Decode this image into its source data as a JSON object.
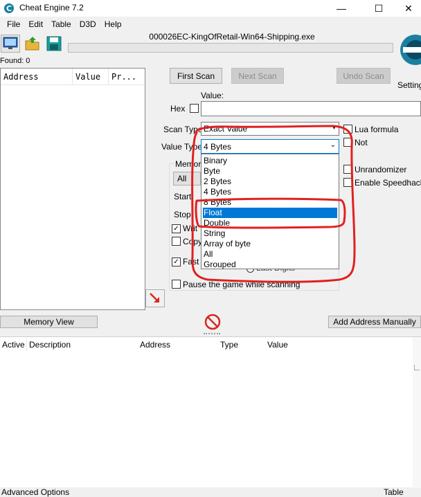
{
  "window": {
    "title": "Cheat Engine 7.2",
    "minimize": "—",
    "maximize": "☐",
    "close": "✕"
  },
  "menu": [
    "File",
    "Edit",
    "Table",
    "D3D",
    "Help"
  ],
  "process": {
    "name": "000026EC-KingOfRetail-Win64-Shipping.exe",
    "found_label": "Found: 0"
  },
  "address_list": {
    "columns": [
      "Address",
      "Value",
      "Pr..."
    ]
  },
  "scan": {
    "first_scan": "First Scan",
    "next_scan": "Next Scan",
    "undo_scan": "Undo Scan",
    "settings": "Settings",
    "value_label": "Value:",
    "hex_label": "Hex",
    "scan_type_label": "Scan Type",
    "scan_type_value": "Exact Value",
    "value_type_label": "Value Type",
    "value_type_value": "4 Bytes",
    "memory_label": "Memor",
    "all_label": "All",
    "start_label": "Start",
    "stop_label": "Stop",
    "writable_label": "Writ",
    "copy_label": "Copy",
    "fast_label": "Fast S",
    "last_digits": "Last Digits",
    "pause_label": "Pause the game while scanning"
  },
  "options": {
    "lua_formula": "Lua formula",
    "not": "Not",
    "unrandomizer": "Unrandomizer",
    "speedhack": "Enable Speedhack"
  },
  "value_type_options": [
    "Binary",
    "Byte",
    "2 Bytes",
    "4 Bytes",
    "8 Bytes",
    "Float",
    "Double",
    "String",
    "Array of byte",
    "All",
    "Grouped"
  ],
  "selected_option": "Float",
  "buttons": {
    "memory_view": "Memory View",
    "add_address": "Add Address Manually"
  },
  "cheat_table": {
    "columns": [
      "Active",
      "Description",
      "Address",
      "Type",
      "Value"
    ]
  },
  "status": {
    "advanced": "Advanced Options",
    "table_extras": "Table Extras"
  },
  "colors": {
    "selection": "#0078d7",
    "annotation": "#e0201e"
  }
}
